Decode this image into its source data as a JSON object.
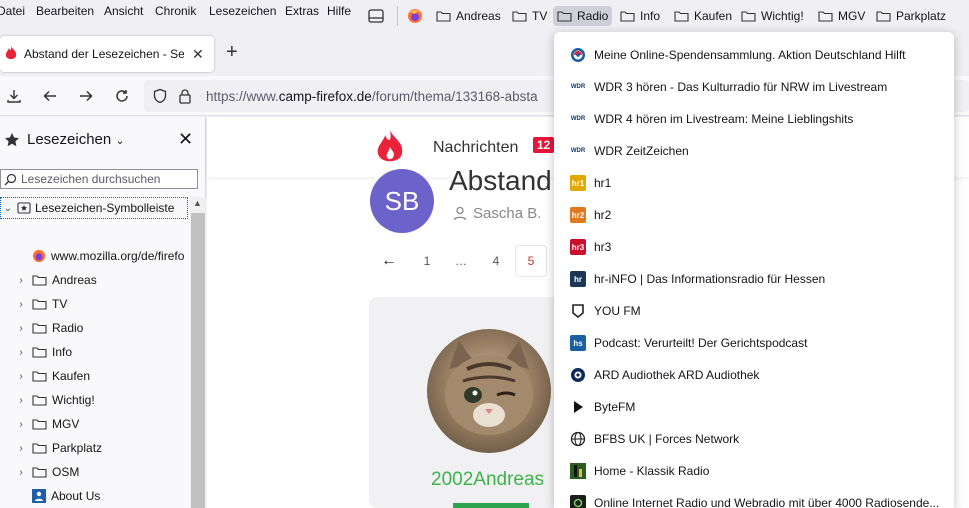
{
  "menu": [
    "Datei",
    "Bearbeiten",
    "Ansicht",
    "Chronik",
    "Lesezeichen",
    "Extras",
    "Hilfe"
  ],
  "bookmarks_toolbar": [
    "Andreas",
    "TV",
    "Radio",
    "Info",
    "Kaufen",
    "Wichtig!",
    "MGV",
    "Parkplatz"
  ],
  "tab": {
    "title": "Abstand der Lesezeichen - Seite",
    "new_tab": "+"
  },
  "url": {
    "prefix": "https://www.",
    "domain": "camp-firefox.de",
    "path": "/forum/thema/133168-absta"
  },
  "sidebar": {
    "title": "Lesezeichen",
    "close": "✕",
    "search_placeholder": "Lesezeichen durchsuchen",
    "root": "Lesezeichen-Symbolleiste",
    "items": [
      {
        "label": "www.mozilla.org/de/firefo",
        "type": "link"
      },
      {
        "label": "Andreas",
        "type": "folder"
      },
      {
        "label": "TV",
        "type": "folder"
      },
      {
        "label": "Radio",
        "type": "folder"
      },
      {
        "label": "Info",
        "type": "folder"
      },
      {
        "label": "Kaufen",
        "type": "folder"
      },
      {
        "label": "Wichtig!",
        "type": "folder"
      },
      {
        "label": "MGV",
        "type": "folder"
      },
      {
        "label": "Parkplatz",
        "type": "folder"
      },
      {
        "label": "OSM",
        "type": "folder"
      },
      {
        "label": "About Us",
        "type": "link"
      }
    ]
  },
  "site": {
    "nav_label": "Nachrichten",
    "nav_badge": "12",
    "avatar_initials": "SB",
    "thread_title": "Abstand",
    "thread_author": "Sascha B.",
    "pagination": [
      "←",
      "1",
      "…",
      "4",
      "5"
    ],
    "post_user": "2002Andreas"
  },
  "popup": {
    "items": [
      {
        "label": "Meine Online-Spendensammlung. Aktion Deutschland Hilft",
        "icon": "spenden-icon",
        "text": "",
        "color": "#ffffff"
      },
      {
        "label": "WDR 3 hören - Das Kulturradio für NRW im Livestream",
        "icon": "wdr-icon",
        "text": "WDR",
        "color": "#0a3a6a"
      },
      {
        "label": "WDR 4 hören im Livestream: Meine Lieblingshits",
        "icon": "wdr-icon",
        "text": "WDR",
        "color": "#0a3a6a"
      },
      {
        "label": "WDR ZeitZeichen",
        "icon": "wdr-icon",
        "text": "WDR",
        "color": "#0a3a6a"
      },
      {
        "label": "hr1",
        "icon": "hr1-icon",
        "text": "hr1",
        "color": "#e0a800"
      },
      {
        "label": "hr2",
        "icon": "hr2-icon",
        "text": "hr2",
        "color": "#e07a20"
      },
      {
        "label": "hr3",
        "icon": "hr3-icon",
        "text": "hr3",
        "color": "#c8102e"
      },
      {
        "label": "hr-iNFO | Das Informationsradio für Hessen",
        "icon": "hr-info-icon",
        "text": "hr",
        "color": "#1d3557"
      },
      {
        "label": "YOU FM",
        "icon": "youfm-icon",
        "text": "",
        "color": "#ffffff"
      },
      {
        "label": "Podcast: Verurteilt! Der Gerichtspodcast",
        "icon": "hs-icon",
        "text": "hs",
        "color": "#1a5fa0"
      },
      {
        "label": "ARD Audiothek  ARD Audiothek",
        "icon": "ard-icon",
        "text": "",
        "color": "#0b2a5b"
      },
      {
        "label": "ByteFM",
        "icon": "play-icon",
        "text": "",
        "color": "#ffffff"
      },
      {
        "label": "BFBS UK | Forces Network",
        "icon": "globe-icon",
        "text": "",
        "color": "#ffffff"
      },
      {
        "label": "Home - Klassik Radio",
        "icon": "klassik-icon",
        "text": "",
        "color": "#2b5e1e"
      },
      {
        "label": "Online Internet Radio und Webradio mit über 4000 Radiosende...",
        "icon": "radio-de-icon",
        "text": "",
        "color": "#1c1c1c"
      }
    ]
  }
}
